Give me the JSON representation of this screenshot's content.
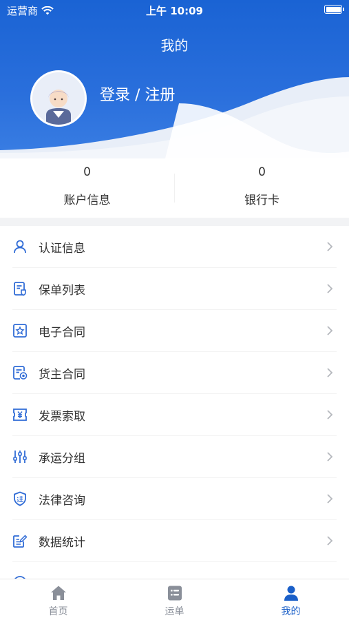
{
  "status_bar": {
    "carrier": "运营商",
    "time": "上午 10:09"
  },
  "header": {
    "title": "我的",
    "login_text": "登录 / 注册"
  },
  "stats": [
    {
      "value": "0",
      "label": "账户信息"
    },
    {
      "value": "0",
      "label": "银行卡"
    }
  ],
  "menu": [
    {
      "label": "认证信息",
      "icon": "user-icon"
    },
    {
      "label": "保单列表",
      "icon": "policy-list-icon"
    },
    {
      "label": "电子合同",
      "icon": "e-contract-icon"
    },
    {
      "label": "货主合同",
      "icon": "shipper-contract-icon"
    },
    {
      "label": "发票索取",
      "icon": "invoice-icon"
    },
    {
      "label": "承运分组",
      "icon": "sliders-icon"
    },
    {
      "label": "法律咨询",
      "icon": "law-shield-icon"
    },
    {
      "label": "数据统计",
      "icon": "data-stats-icon"
    },
    {
      "label": "",
      "icon": "more-icon"
    }
  ],
  "tabbar": [
    {
      "label": "首页",
      "icon": "home-icon",
      "active": false
    },
    {
      "label": "运单",
      "icon": "waybill-icon",
      "active": false
    },
    {
      "label": "我的",
      "icon": "profile-icon",
      "active": true
    }
  ],
  "colors": {
    "brand": "#1a63d4",
    "active_tab": "#1a5fc8",
    "icon_blue": "#2f6bd6",
    "inactive_tab": "#8a8f99"
  }
}
